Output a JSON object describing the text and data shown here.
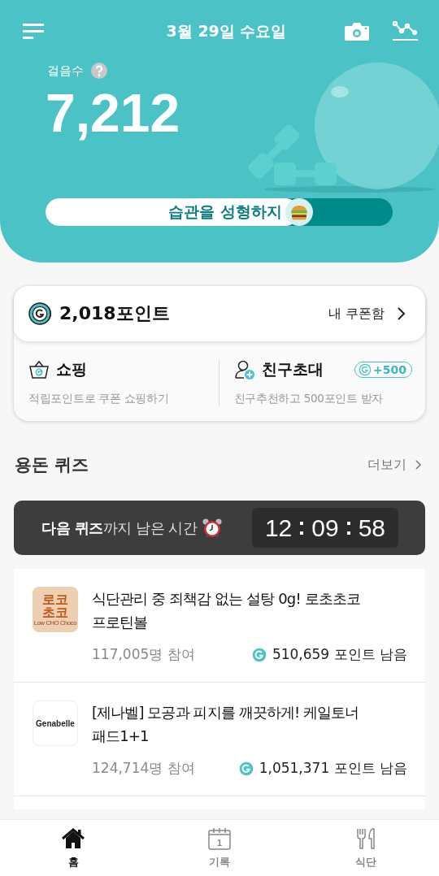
{
  "header": {
    "date": "3월 29일 수요일",
    "steps_label": "걸음수",
    "steps": "7,212",
    "habit": {
      "text": "습관을 성형하지",
      "level": 0.73
    }
  },
  "points": {
    "amount": "2,018포인트",
    "coupon_link": "내 쿠폰함"
  },
  "shortcuts": [
    {
      "kind": "shop",
      "title": "쇼핑",
      "desc": "적립포인트로 쿠폰 쇼핑하기"
    },
    {
      "kind": "invite",
      "title": "친구초대",
      "desc": "친구추천하고 500포인트 받자",
      "badge": "+500"
    }
  ],
  "quiz": {
    "title": "용돈 퀴즈",
    "more": "더보기",
    "timer_label": "**다음 퀴즈**까지 남은 시간",
    "timer": [
      "12",
      "09",
      "58"
    ],
    "items": [
      {
        "logo": {
          "kind": "locho",
          "lines": [
            "로코",
            "초코"
          ],
          "sub": "Low CHO Choco"
        },
        "title": "식단관리 중 죄책감 없는 설탕 0g! 로초초코 프로틴볼",
        "participants": "117,005명 참여",
        "remaining": "510,659 포인트 남음"
      },
      {
        "logo": {
          "kind": "plain",
          "lines": [
            "Genabelle"
          ]
        },
        "title": "[제나벨] 모공과 피지를 깨끗하게! 케일토너 패드1+1",
        "participants": "124,714명 참여",
        "remaining": "1,051,371 포인트 남음"
      }
    ]
  },
  "nav": [
    {
      "kind": "home",
      "label": "홈",
      "selected": true
    },
    {
      "kind": "calendar",
      "label": "기록",
      "icon_text": "1",
      "selected": false
    },
    {
      "kind": "meal",
      "label": "식단",
      "selected": false
    }
  ]
}
